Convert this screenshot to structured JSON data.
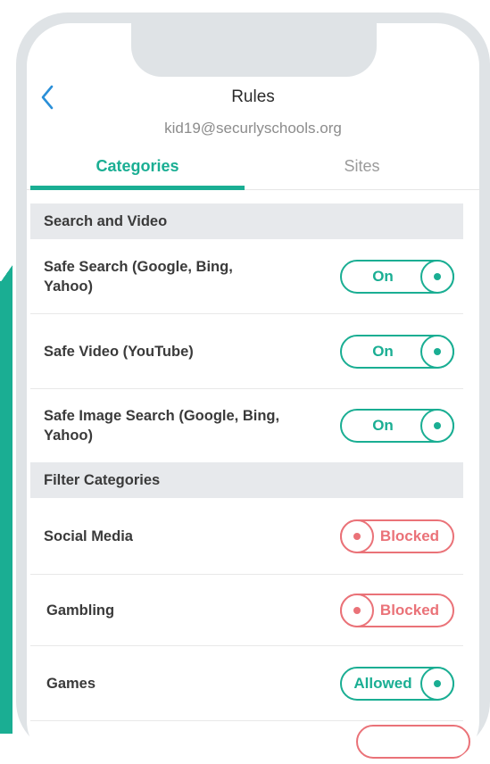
{
  "header": {
    "title": "Rules",
    "subtitle": "kid19@securlyschools.org"
  },
  "tabs": [
    {
      "label": "Categories",
      "active": true
    },
    {
      "label": "Sites",
      "active": false
    }
  ],
  "sections": [
    {
      "title": "Search and Video",
      "rows": [
        {
          "label": "Safe Search (Google, Bing, Yahoo)",
          "state": "On"
        },
        {
          "label": "Safe Video (YouTube)",
          "state": "On"
        },
        {
          "label": "Safe Image Search (Google, Bing, Yahoo)",
          "state": "On"
        }
      ]
    },
    {
      "title": "Filter Categories",
      "rows": [
        {
          "label": "Social Media",
          "state": "Blocked"
        },
        {
          "label": "Gambling",
          "state": "Blocked"
        },
        {
          "label": "Games",
          "state": "Allowed"
        }
      ]
    }
  ],
  "colors": {
    "accent": "#1aae93",
    "blocked": "#ea7278",
    "back_arrow": "#2a8fd8",
    "section_bg": "#e7e9ec"
  },
  "icons": {
    "back": "chevron-left-icon"
  }
}
